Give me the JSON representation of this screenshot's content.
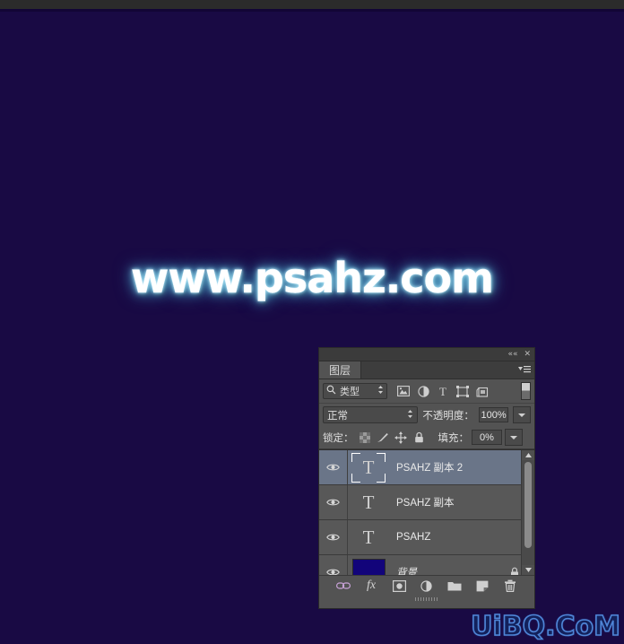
{
  "canvas": {
    "background_color": "#190a44",
    "top_strip_color": "#2b2b2b",
    "watermark_main": "www.psahz.com",
    "watermark_corner": "UiBQ.CoM"
  },
  "panel": {
    "title_tab": "图层",
    "collapse_icon": "««",
    "close_icon": "✕",
    "menu_icon": "panel-menu-icon",
    "filter": {
      "search_icon": "search-icon",
      "kind_label": "类型",
      "icons": [
        {
          "name": "filter-pixel-icon"
        },
        {
          "name": "filter-adjustment-icon"
        },
        {
          "name": "filter-type-icon"
        },
        {
          "name": "filter-shape-icon"
        },
        {
          "name": "filter-smartobject-icon"
        }
      ],
      "toggle_name": "filter-enable-toggle"
    },
    "blend": {
      "mode": "正常",
      "opacity_label": "不透明度：",
      "opacity_value": "100%"
    },
    "lock": {
      "lock_label": "锁定：",
      "icons": [
        {
          "name": "lock-transparent-pixels-icon"
        },
        {
          "name": "lock-image-pixels-icon"
        },
        {
          "name": "lock-position-icon"
        },
        {
          "name": "lock-all-icon"
        }
      ],
      "fill_label": "填充：",
      "fill_value": "0%"
    },
    "layers": [
      {
        "name": "PSAHZ 副本 2",
        "thumb": "type",
        "selected": true,
        "locked": false
      },
      {
        "name": "PSAHZ 副本",
        "thumb": "type",
        "selected": false,
        "locked": false
      },
      {
        "name": "PSAHZ",
        "thumb": "type",
        "selected": false,
        "locked": false
      },
      {
        "name": "背景",
        "thumb": "color",
        "thumb_color": "#12047a",
        "selected": false,
        "locked": true
      }
    ],
    "bottom_buttons": [
      {
        "name": "link-layers-button",
        "glyph": "link"
      },
      {
        "name": "layer-style-button",
        "glyph": "fx"
      },
      {
        "name": "layer-mask-button",
        "glyph": "mask"
      },
      {
        "name": "adjustment-layer-button",
        "glyph": "adjust"
      },
      {
        "name": "new-group-button",
        "glyph": "folder"
      },
      {
        "name": "new-layer-button",
        "glyph": "newlayer"
      },
      {
        "name": "delete-layer-button",
        "glyph": "trash"
      }
    ],
    "colors": {
      "panel_bg": "#535353",
      "row_bg": "#585858",
      "row_selected_bg": "#6a7588",
      "text": "#e0e0e0"
    }
  }
}
